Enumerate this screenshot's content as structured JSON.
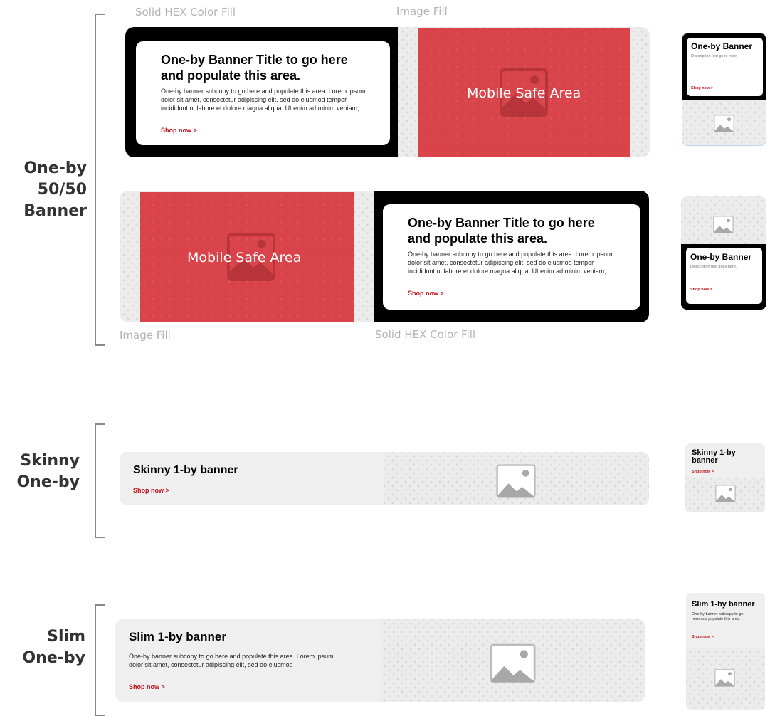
{
  "labels": {
    "solid_hex_fill": "Solid HEX Color Fill",
    "image_fill": "Image Fill",
    "mobile_safe_area": "Mobile Safe Area"
  },
  "sections": {
    "one_by_5050": [
      "One-by",
      "50/50",
      "Banner"
    ],
    "skinny": [
      "Skinny",
      "One-by"
    ],
    "slim": [
      "Slim",
      "One-by"
    ]
  },
  "one_by_banner": {
    "title_line1": "One-by Banner Title to go here",
    "title_line2": "and populate this area.",
    "body_line1": "One-by banner subcopy to go here and populate this area. Lorem ipsum",
    "body_line2": "dolor sit amet, consectetur adipiscing elit, sed do eiusmod tempor",
    "body_line3": "incididunt ut labore et dolore magna aliqua. Ut enim ad minim veniam,",
    "cta": "Shop now >",
    "mobile_title": "One-by Banner",
    "mobile_desc": "Description text goes here."
  },
  "skinny_banner": {
    "title": "Skinny 1-by banner",
    "mobile_title_line1": "Skinny 1-by",
    "mobile_title_line2": "banner",
    "cta": "Shop now >"
  },
  "slim_banner": {
    "title": "Slim 1-by banner",
    "body_line1": "One-by banner subcopy to go here and populate this area. Lorem ipsum",
    "body_line2": "dolor sit amet, consectetur adipiscing elit, sed do eiusmod",
    "mobile_body_line1": "One-by banner subcopy to go",
    "mobile_body_line2": "here and populate this area.",
    "cta": "Shop now >"
  },
  "colors": {
    "accent": "#c0121b",
    "safe_area": "#d9444a",
    "fill": "#000000",
    "placeholder": "#ececec"
  },
  "icons": [
    "image-placeholder-icon"
  ]
}
